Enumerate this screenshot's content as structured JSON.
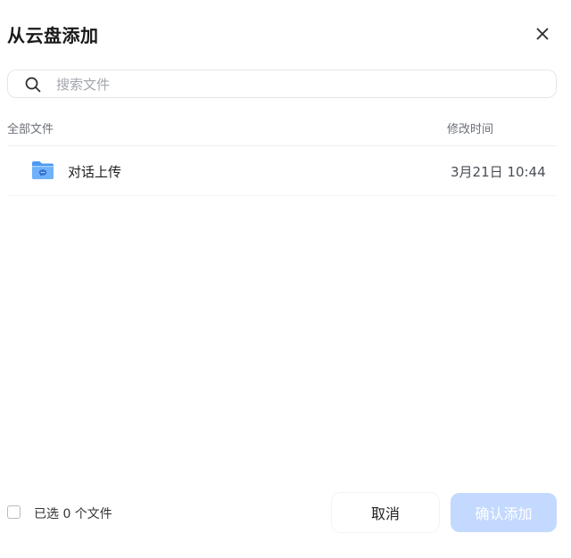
{
  "dialog": {
    "title": "从云盘添加"
  },
  "search": {
    "placeholder": "搜索文件"
  },
  "table": {
    "columns": [
      "全部文件",
      "修改时间"
    ],
    "rows": [
      {
        "name": "对话上传",
        "modified": "3月21日 10:44",
        "icon": "chat-folder-icon"
      }
    ]
  },
  "footer": {
    "selection_text": "已选 0 个文件",
    "cancel_label": "取消",
    "confirm_label": "确认添加"
  },
  "colors": {
    "accent": "#4a8cff",
    "confirm_disabled": "#c3d9ff",
    "folder": "#4a9af5"
  }
}
